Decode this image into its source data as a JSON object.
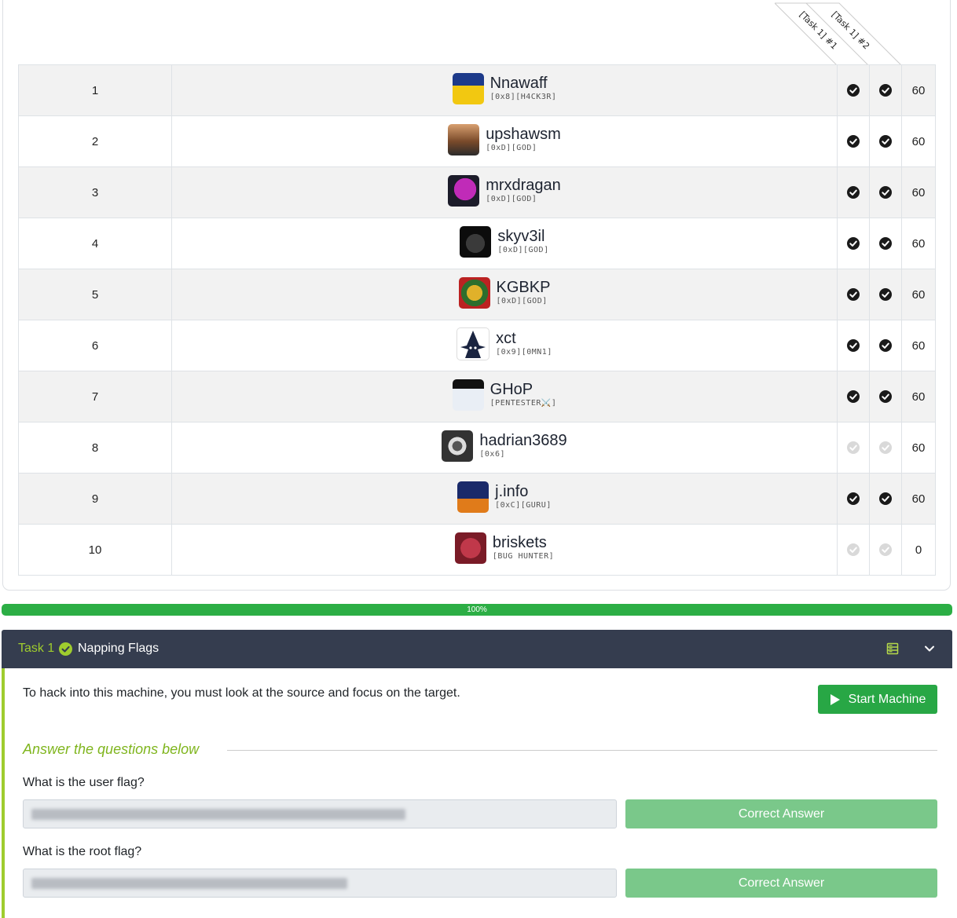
{
  "scoreboard": {
    "task_headers": [
      "[Task 1] #1",
      "[Task 1] #2"
    ],
    "rows": [
      {
        "rank": "1",
        "name": "Nnawaff",
        "badge": "[0x8][H4CK3R]",
        "q1": "done",
        "q2": "done",
        "score": "60"
      },
      {
        "rank": "2",
        "name": "upshawsm",
        "badge": "[0xD][GOD]",
        "q1": "done",
        "q2": "done",
        "score": "60"
      },
      {
        "rank": "3",
        "name": "mrxdragan",
        "badge": "[0xD][GOD]",
        "q1": "done",
        "q2": "done",
        "score": "60"
      },
      {
        "rank": "4",
        "name": "skyv3il",
        "badge": "[0xD][GOD]",
        "q1": "done",
        "q2": "done",
        "score": "60"
      },
      {
        "rank": "5",
        "name": "KGBKP",
        "badge": "[0xD][GOD]",
        "q1": "done",
        "q2": "done",
        "score": "60"
      },
      {
        "rank": "6",
        "name": "xct",
        "badge": "[0x9][0MN1]",
        "q1": "done",
        "q2": "done",
        "score": "60"
      },
      {
        "rank": "7",
        "name": "GHoP",
        "badge": "[PENTESTER⚔️]",
        "q1": "done",
        "q2": "done",
        "score": "60"
      },
      {
        "rank": "8",
        "name": "hadrian3689",
        "badge": "[0x6]",
        "q1": "pending",
        "q2": "pending",
        "score": "60"
      },
      {
        "rank": "9",
        "name": "j.info",
        "badge": "[0xC][GURU]",
        "q1": "done",
        "q2": "done",
        "score": "60"
      },
      {
        "rank": "10",
        "name": "briskets",
        "badge": "[BUG HUNTER]",
        "q1": "pending",
        "q2": "pending",
        "score": "0"
      }
    ]
  },
  "progress": {
    "label": "100%",
    "value": 1.0
  },
  "task": {
    "number": "Task 1",
    "title": "Napping Flags",
    "description": "To hack into this machine, you must look at the source and focus on the target.",
    "start_button": "Start Machine",
    "answer_heading": "Answer the questions below",
    "questions": [
      {
        "label": "What is the user flag?",
        "button": "Correct Answer"
      },
      {
        "label": "What is the root flag?",
        "button": "Correct Answer"
      }
    ]
  },
  "colors": {
    "accent_green": "#28a745",
    "task_green": "#9fcc2e",
    "header_dark": "#353d4f",
    "correct_button": "#7ac88a"
  }
}
